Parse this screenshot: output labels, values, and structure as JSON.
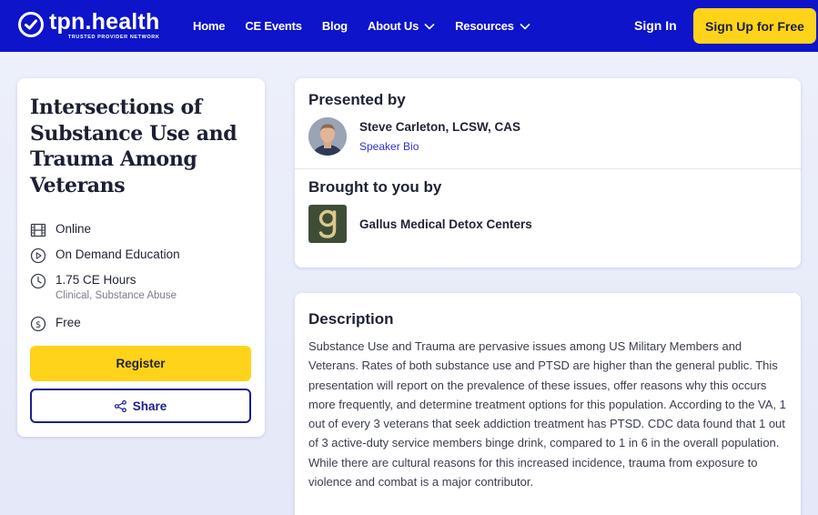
{
  "header": {
    "logo_name": "tpn.health",
    "logo_tagline": "TRUSTED PROVIDER NETWORK",
    "nav": [
      {
        "label": "Home",
        "has_menu": false
      },
      {
        "label": "CE Events",
        "has_menu": false
      },
      {
        "label": "Blog",
        "has_menu": false
      },
      {
        "label": "About Us",
        "has_menu": true
      },
      {
        "label": "Resources",
        "has_menu": true
      }
    ],
    "sign_in": "Sign In",
    "sign_up": "Sign Up for Free"
  },
  "event": {
    "title": "Intersections of Substance Use and Trauma Among Veterans",
    "format": "Online",
    "type": "On Demand Education",
    "hours": "1.75 CE Hours",
    "categories": "Clinical, Substance Abuse",
    "price": "Free",
    "register_label": "Register",
    "share_label": "Share"
  },
  "presenter": {
    "section_title": "Presented by",
    "name": "Steve Carleton, LCSW, CAS",
    "bio_link": "Speaker Bio"
  },
  "sponsor": {
    "section_title": "Brought to you by",
    "name": "Gallus Medical Detox Centers"
  },
  "description": {
    "section_title": "Description",
    "body": "Substance Use and Trauma are pervasive issues among US Military Members and Veterans. Rates of both substance use and PTSD are higher than the general public. This presentation will report on the prevalence of these issues, offer reasons why this occurs more frequently, and determine treatment options for this population. According to the VA, 1 out of every 3 veterans that seek addiction treatment has PTSD. CDC data found that 1 out of 3 active-duty service members binge drink, compared to 1 in 6 in the overall population. While there are cultural reasons for this increased incidence, trauma from exposure to violence and combat is a major contributor."
  },
  "colors": {
    "brand_blue": "#0d14c9",
    "accent_yellow": "#ffd31a",
    "link_blue": "#2b33c7"
  },
  "icons": {
    "format": "film-icon",
    "type": "play-circle-icon",
    "hours": "clock-icon",
    "price": "dollar-circle-icon",
    "share": "share-icon",
    "menu": "chevron-down-icon"
  }
}
